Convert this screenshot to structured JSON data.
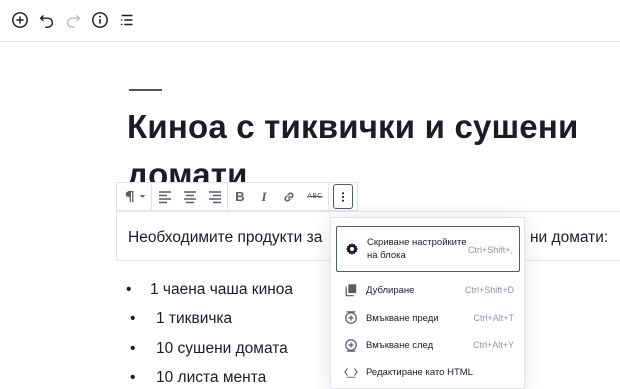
{
  "toolbar": {
    "icons": [
      "add-block-icon",
      "undo-icon",
      "redo-icon",
      "info-icon",
      "outline-icon"
    ]
  },
  "post": {
    "title_line1": "Киноа с тиквички и сушени",
    "title_line2": "домати",
    "paragraph": "Необходимите продукти за",
    "paragraph_tail": "ни домати:"
  },
  "block_toolbar": {
    "icons": [
      "paragraph-icon",
      "align-left-icon",
      "align-center-icon",
      "align-right-icon",
      "bold-icon",
      "italic-icon",
      "link-icon",
      "strikethrough-icon",
      "more-options-icon"
    ],
    "bold": "B",
    "italic": "I",
    "strike": "ABC"
  },
  "list": {
    "items": [
      "1 чаена чаша киноа",
      "1 тиквичка",
      "10 сушени домата",
      "10 листа мента"
    ]
  },
  "menu": {
    "items": [
      {
        "label": "Скриване настройките на блока",
        "shortcut": "Ctrl+Shift+,",
        "icon": "gear-icon"
      },
      {
        "label": "Дублиране",
        "shortcut": "Ctrl+Shift+D",
        "icon": "duplicate-icon"
      },
      {
        "label": "Вмъкване преди",
        "shortcut": "Ctrl+Alt+T",
        "icon": "insert-before-icon"
      },
      {
        "label": "Вмъкване след",
        "shortcut": "Ctrl+Alt+Y",
        "icon": "insert-after-icon"
      },
      {
        "label": "Редактиране като HTML",
        "shortcut": "",
        "icon": "html-icon"
      }
    ]
  },
  "colors": {
    "text": "#191e23",
    "icon": "#555d66",
    "border": "#e2e4e7",
    "shortcut": "#8d96a0"
  }
}
